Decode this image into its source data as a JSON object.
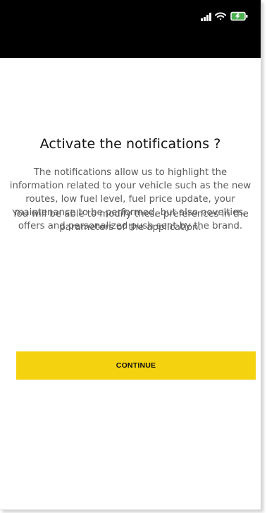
{
  "status_bar": {
    "icons": [
      "signal-icon",
      "wifi-icon",
      "battery-charging-icon"
    ]
  },
  "dialog": {
    "title": "Activate the notifications ?",
    "paragraph_1": "The notifications allow us to highlight the information related to your vehicle such as the new routes, low fuel level, fuel price update, your maintenance to be performed, but also novelties, offers and personalized push sent by the brand.",
    "paragraph_2": "You will be able to modify these preferences in the parameters of the application.",
    "continue_label": "CONTINUE"
  },
  "colors": {
    "status_bar_bg": "#000000",
    "accent": "#f4d20f",
    "title_text": "#111111",
    "body_text": "#5b5b5b",
    "battery": "#4caf50"
  }
}
